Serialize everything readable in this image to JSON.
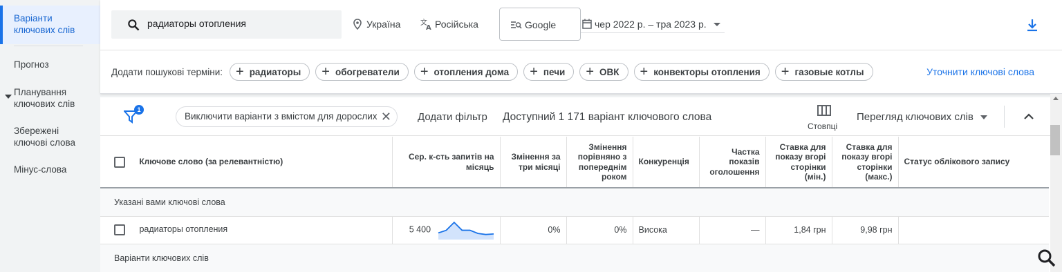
{
  "sidebar": {
    "items": [
      {
        "label_line1": "Варіанти",
        "label_line2": "ключових слів",
        "active": true
      },
      {
        "label_line1": "Прогноз",
        "label_line2": ""
      },
      {
        "label_line1": "Планування",
        "label_line2": "ключових слів"
      },
      {
        "label_line1": "Збережені",
        "label_line2": "ключові слова"
      },
      {
        "label_line1": "Мінус-слова",
        "label_line2": ""
      }
    ]
  },
  "header": {
    "search_value": "радиаторы отопления",
    "location": "Україна",
    "language": "Російська",
    "network": "Google",
    "date_range": "чер 2022 р. – тра 2023 р."
  },
  "terms": {
    "label": "Додати пошукові терміни:",
    "chips": [
      "радиаторы",
      "обогреватели",
      "отопления дома",
      "печи",
      "ОВК",
      "конвекторы отопления",
      "газовые котлы"
    ],
    "refine_link": "Уточнити ключові слова"
  },
  "toolbar": {
    "filter_count": "1",
    "exclude_chip": "Виключити варіанти з вмістом для дорослих",
    "add_filter": "Додати фільтр",
    "available": "Доступний 1 171 варіант ключового слова",
    "columns_label": "Стовпці",
    "view_label": "Перегляд ключових слів"
  },
  "table": {
    "headers": {
      "keyword": "Ключове слово (за релевантністю)",
      "avg_searches_1": "Сер. к-сть запитів на",
      "avg_searches_2": "місяць",
      "change3m_1": "Змінення за",
      "change3m_2": "три місяці",
      "yoy_1": "Змінення",
      "yoy_2": "порівняно з",
      "yoy_3": "попереднім",
      "yoy_4": "роком",
      "competition": "Конкуренція",
      "impr_1": "Частка",
      "impr_2": "показів",
      "impr_3": "оголошення",
      "bidlow_1": "Ставка для",
      "bidlow_2": "показу вгорі",
      "bidlow_3": "сторінки",
      "bidlow_4": "(мін.)",
      "bidhigh_1": "Ставка для",
      "bidhigh_2": "показу вгорі",
      "bidhigh_3": "сторінки",
      "bidhigh_4": "(макс.)",
      "status": "Статус облікового запису"
    },
    "group1": "Указані вами ключові слова",
    "row": {
      "keyword": "радиаторы отопления",
      "avg_searches": "5 400",
      "trend": [
        2,
        3,
        6,
        3,
        3,
        1.8,
        1.4,
        1.6
      ],
      "change3m": "0%",
      "yoy": "0%",
      "competition": "Висока",
      "impr_share": "—",
      "bid_low": "1,84 грн",
      "bid_high": "9,98 грн",
      "status": ""
    },
    "group2": "Варіанти ключових слів"
  },
  "colors": {
    "accent": "#1a73e8",
    "active_bg": "#e8f0fe",
    "sparkline_fill": "#d2e3fc"
  }
}
